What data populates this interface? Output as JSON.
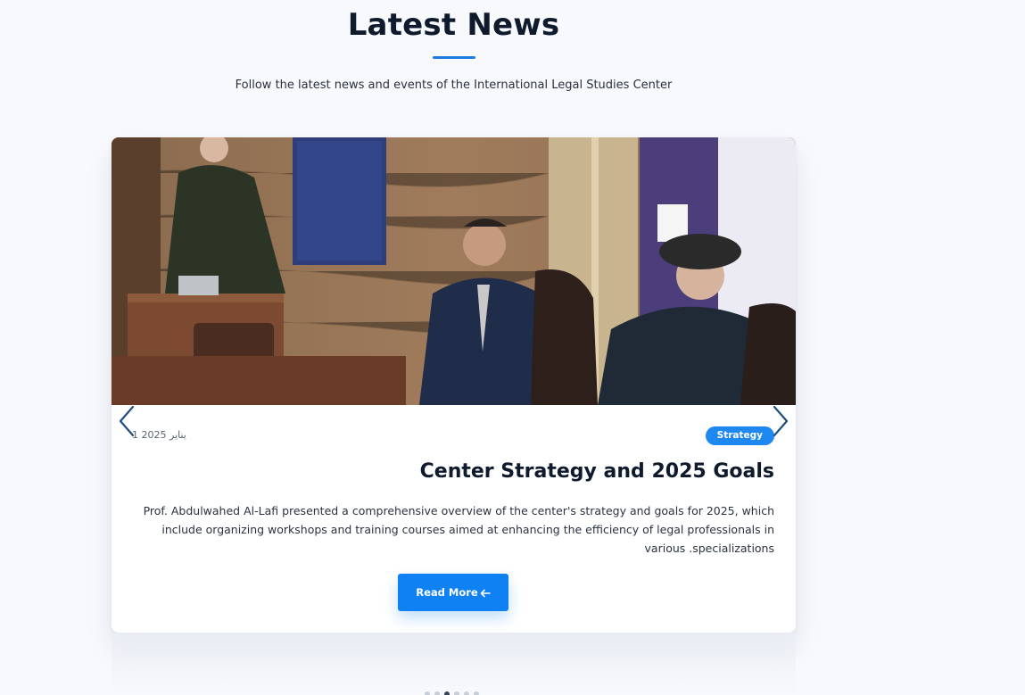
{
  "section": {
    "title": "Latest News",
    "subtitle": "Follow the latest news and events of the International Legal Studies Center"
  },
  "card": {
    "date": "1 يناير 2025",
    "category": "Strategy",
    "title": "Center Strategy and 2025 Goals",
    "description": "Prof. Abdulwahed Al-Lafi presented a comprehensive overview of the center's strategy and goals for 2025, which include organizing workshops and training courses aimed at enhancing the efficiency of legal professionals in various .specializations",
    "read_more": "Read More",
    "image_alt": "Speaker at podium with seated guests"
  },
  "carousel": {
    "prev_icon": "chevron-left-icon",
    "next_icon": "chevron-right-icon",
    "dot_count": 6,
    "active_dot": 2
  },
  "colors": {
    "accent": "#1081f2",
    "badge": "#1e88f0",
    "title": "#0f1b2d"
  }
}
